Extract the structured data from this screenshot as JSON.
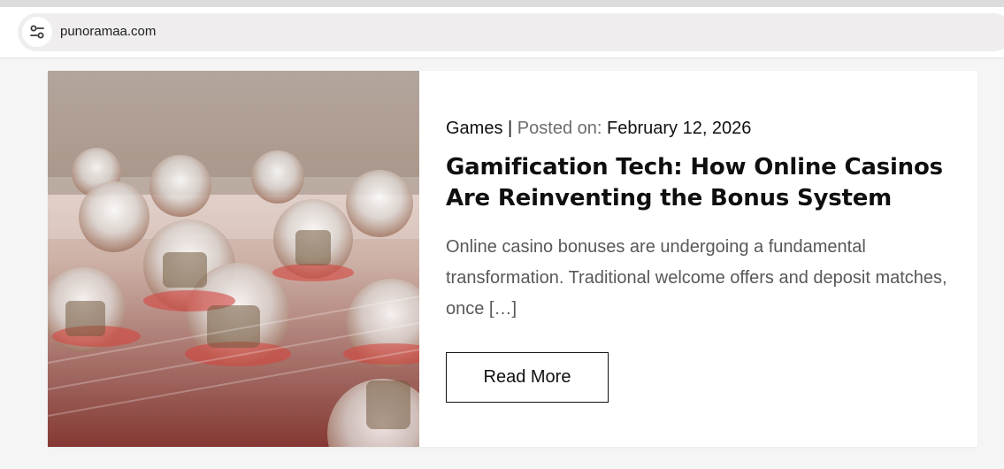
{
  "browser": {
    "url": "punoramaa.com",
    "site_info_icon": "tune-icon"
  },
  "post": {
    "category": "Games",
    "separator": "|",
    "posted_label": "Posted on:",
    "date": "February 12, 2026",
    "title": "Gamification Tech: How Online Casinos Are Reinventing the Bonus System",
    "excerpt": "Online casino bonuses are undergoing a fundamental transformation. Traditional welcome offers and deposit matches, once […]",
    "read_more_label": "Read More",
    "image_alt": "Blurred red casino table with clear glass game pieces"
  }
}
